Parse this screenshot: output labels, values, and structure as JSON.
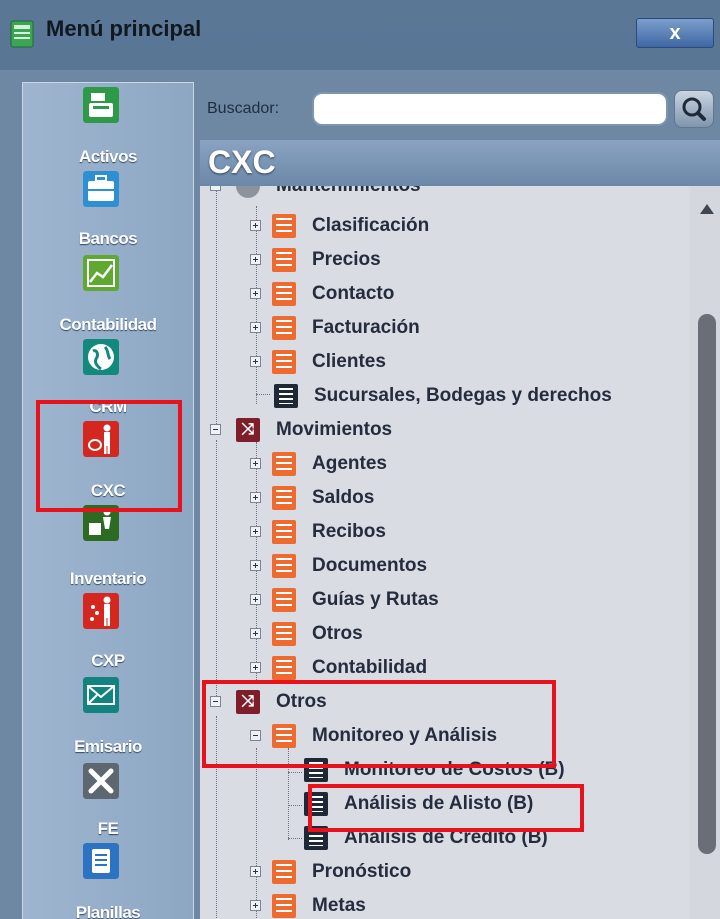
{
  "window": {
    "title": "Menú principal",
    "close_label": "x"
  },
  "sidebar": {
    "items": [
      {
        "label": "Activos",
        "icon": "register-icon",
        "color": "#2c9a47"
      },
      {
        "label": "Bancos",
        "icon": "briefcase-icon",
        "color": "#2f8fd3"
      },
      {
        "label": "Contabilidad",
        "icon": "chart-icon",
        "color": "#5fa832"
      },
      {
        "label": "CRM",
        "icon": "globe-icon",
        "color": "#13897e"
      },
      {
        "label": "CXC",
        "icon": "collector-icon",
        "color": "#d4271f"
      },
      {
        "label": "Inventario",
        "icon": "worker-icon",
        "color": "#2d6b22"
      },
      {
        "label": "CXP",
        "icon": "payer-icon",
        "color": "#d4271f"
      },
      {
        "label": "Emisario",
        "icon": "mail-icon",
        "color": "#12837f"
      },
      {
        "label": "FE",
        "icon": "tools-icon",
        "color": "#5e6670"
      },
      {
        "label": "Planillas",
        "icon": "document-icon",
        "color": "#2c74c2"
      }
    ]
  },
  "search": {
    "label": "Buscador:",
    "value": "",
    "placeholder": ""
  },
  "module": {
    "title": "CXC"
  },
  "tree": {
    "top_partial": "Mantenimientos",
    "mantenimientos_children": [
      "Clasificación",
      "Precios",
      "Contacto",
      "Facturación",
      "Clientes",
      "Sucursales, Bodegas y derechos"
    ],
    "movimientos": {
      "label": "Movimientos",
      "children": [
        "Agentes",
        "Saldos",
        "Recibos",
        "Documentos",
        "Guías y Rutas",
        "Otros",
        "Contabilidad"
      ]
    },
    "otros": {
      "label": "Otros",
      "monitoreo": {
        "label": "Monitoreo y Análisis",
        "children": [
          "Monitoreo de Costos (B)",
          "Análisis de Alisto (B)",
          "Análisis de Crédito (B)"
        ]
      },
      "children_after": [
        "Pronóstico",
        "Metas"
      ]
    }
  },
  "colors": {
    "highlight": "#e8121d",
    "tree_icon_orange": "#ef6a2e",
    "tree_icon_maroon": "#7d1e2a"
  }
}
